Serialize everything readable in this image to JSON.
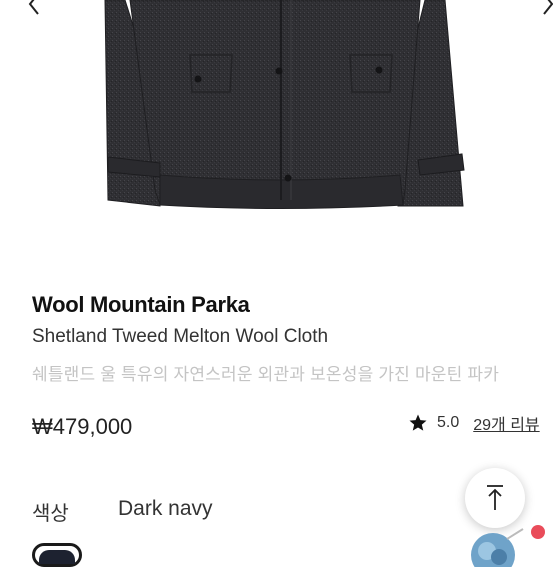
{
  "product": {
    "name": "Wool Mountain Parka",
    "subtitle": "Shetland Tweed Melton Wool Cloth",
    "description": "쉐틀랜드 울 특유의 자연스러운 외관과 보온성을 가진 마운틴 파카",
    "price": "₩479,000"
  },
  "rating": {
    "value": "5.0",
    "reviews_link": "29개 리뷰",
    "icon": "star-icon"
  },
  "color_option": {
    "label": "색상",
    "selected": "Dark navy"
  },
  "gallery": {
    "prev_icon": "chevron-left-icon",
    "next_icon": "chevron-right-icon"
  },
  "colors": {
    "jacket": "#2e2e31",
    "description_text": "#c4c4c4",
    "notification": "#e94c5a"
  }
}
